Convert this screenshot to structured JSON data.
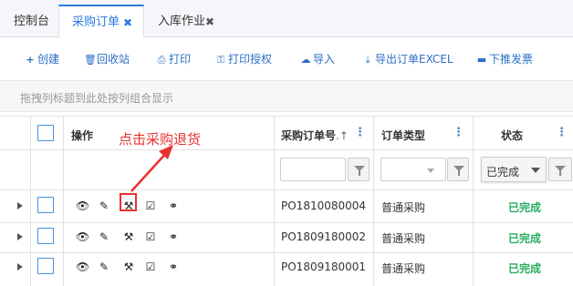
{
  "tabs": [
    {
      "label": "控制台",
      "active": false,
      "closable": false
    },
    {
      "label": "采购订单",
      "active": true,
      "closable": true
    },
    {
      "label": "入库作业",
      "active": false,
      "closable": true
    }
  ],
  "toolbar": {
    "create": "创建",
    "recycle": "回收站",
    "print": "打印",
    "print_auth": "打印授权",
    "import": "导入",
    "export": "导出订单EXCEL",
    "push_invoice": "下推发票"
  },
  "group_hint": "拖拽列标题到此处按列组合显示",
  "columns": {
    "ops": "操作",
    "order_no": "采购订单号",
    "order_type": "订单类型",
    "status": "状态"
  },
  "filters": {
    "status_selected": "已完成"
  },
  "rows": [
    {
      "order_no": "PO1810080004",
      "order_type": "普通采购",
      "status": "已完成"
    },
    {
      "order_no": "PO1809180002",
      "order_type": "普通采购",
      "status": "已完成"
    },
    {
      "order_no": "PO1809180001",
      "order_type": "普通采购",
      "status": "已完成"
    }
  ],
  "annotation": "点击采购退货",
  "colors": {
    "accent": "#2c7be5",
    "status_done": "#27ae60",
    "annotation": "#e8322d"
  }
}
